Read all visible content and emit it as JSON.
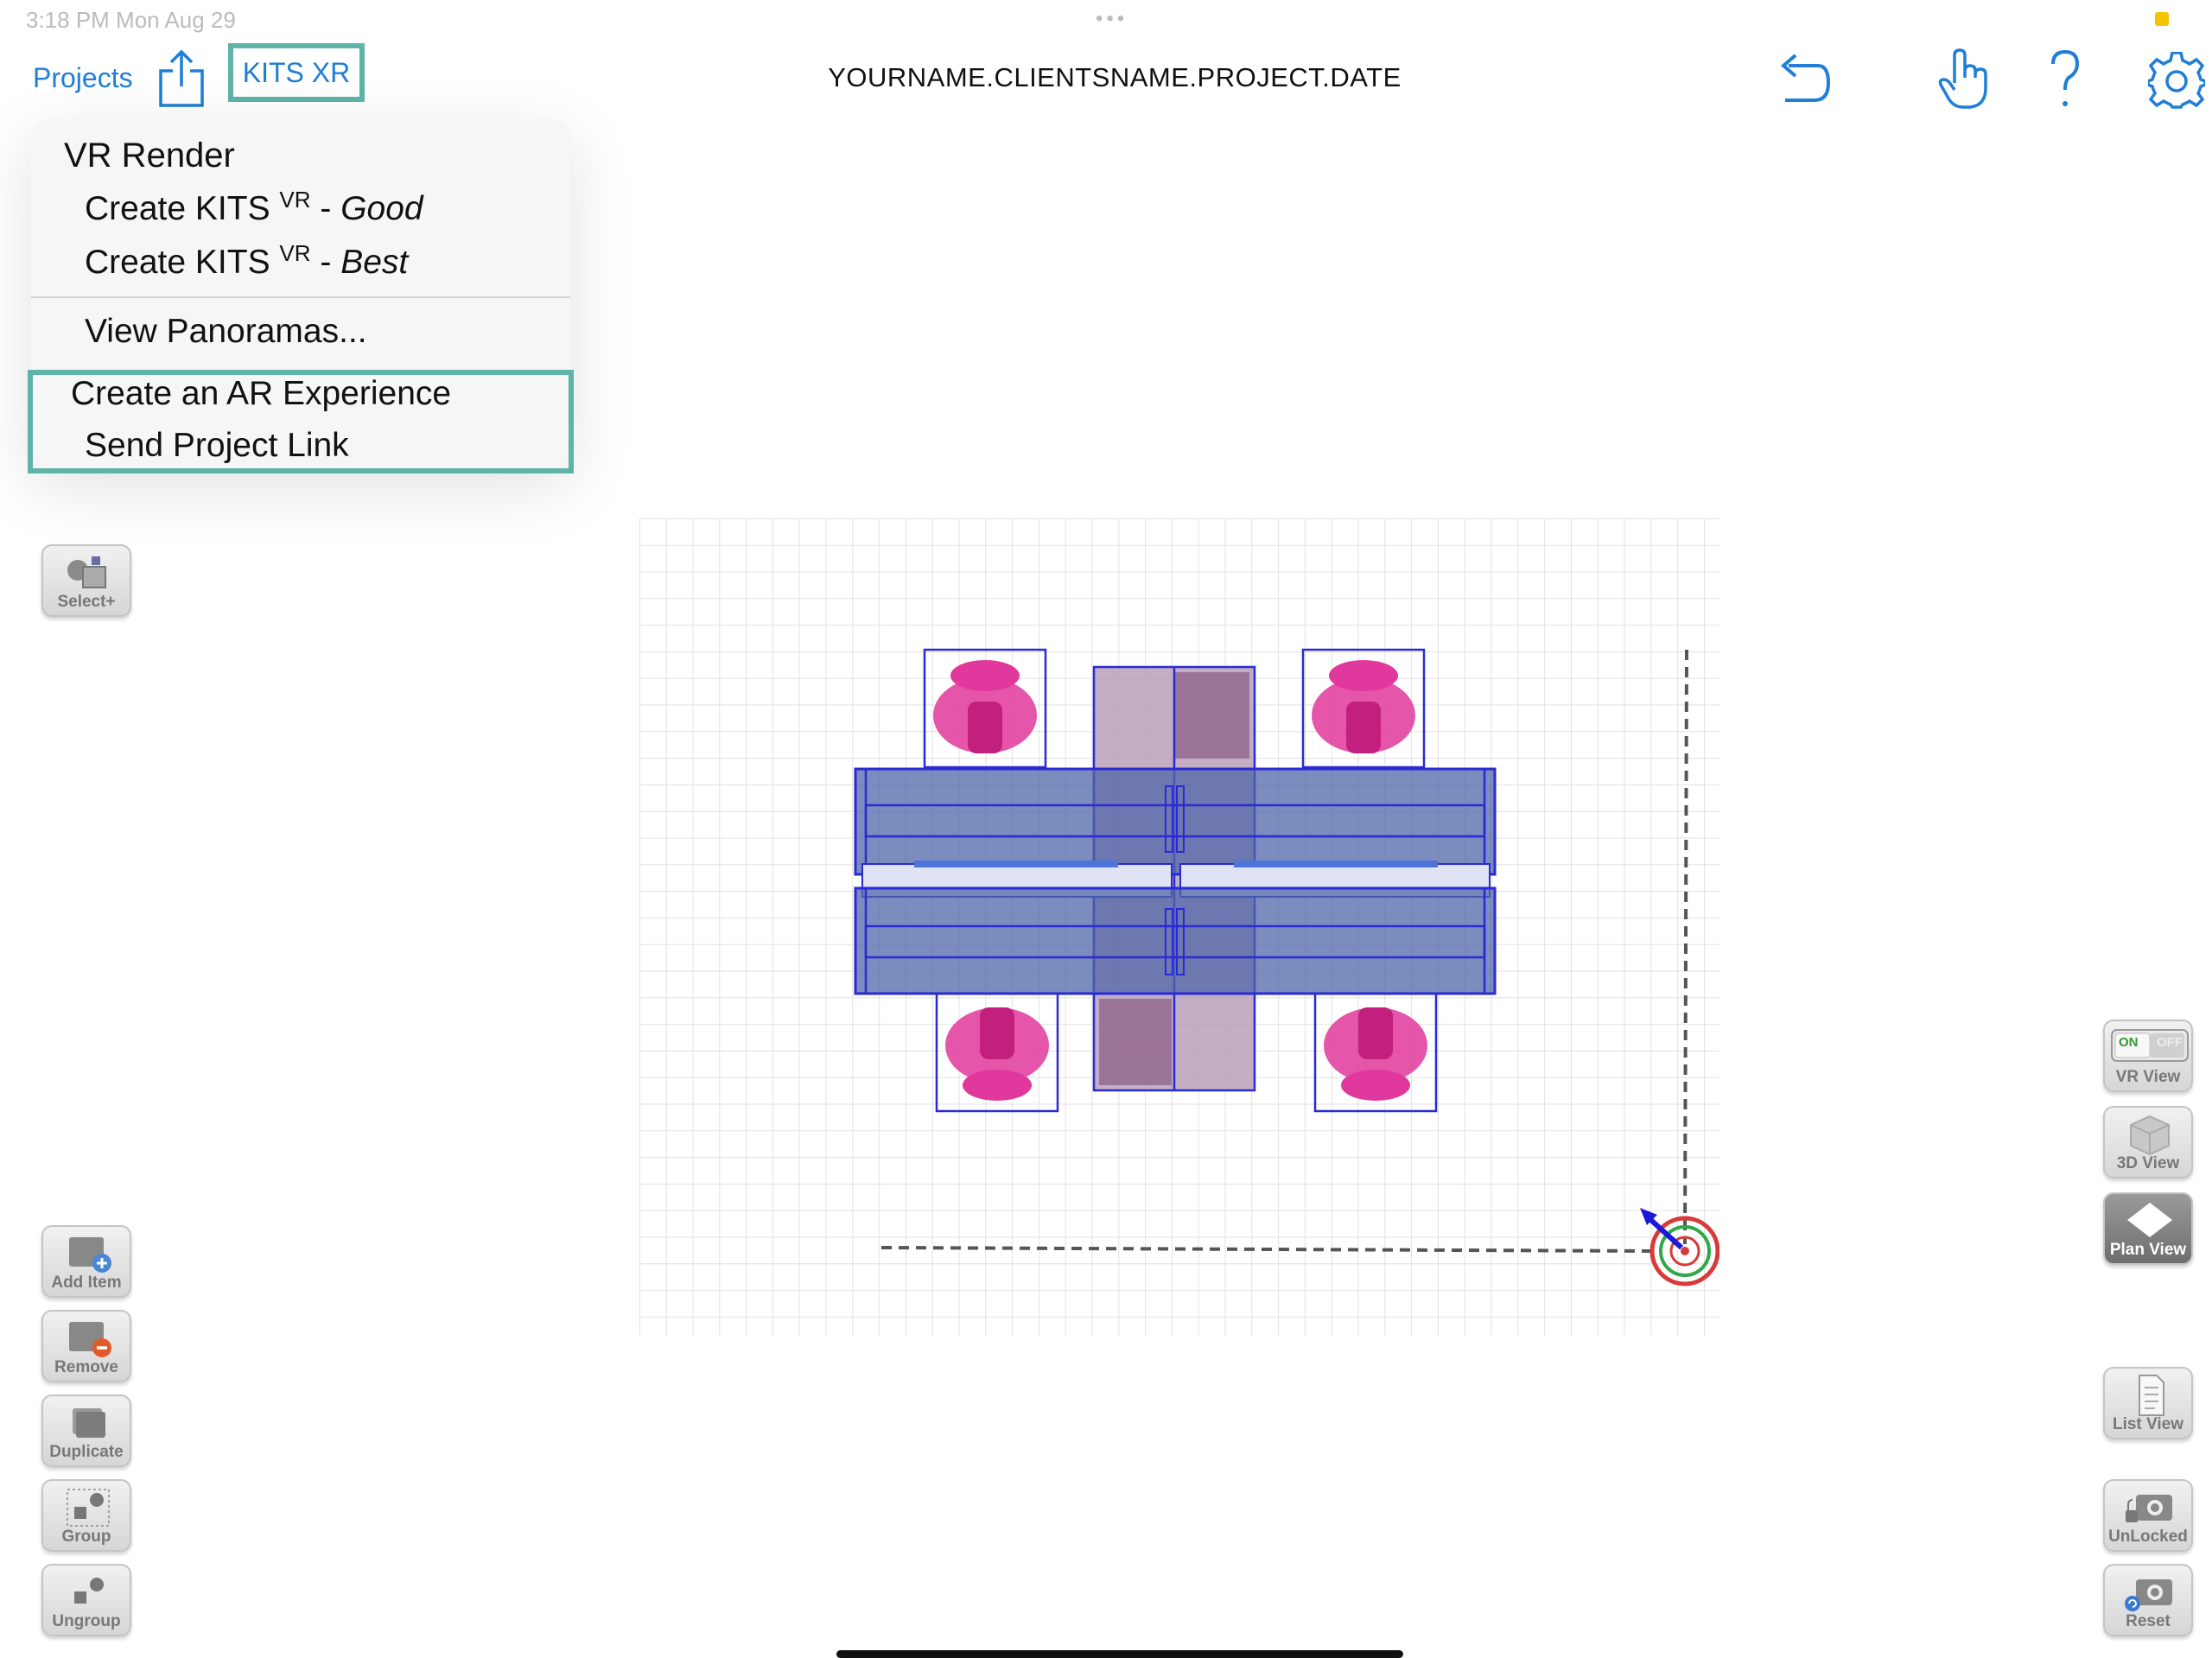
{
  "status_bar": {
    "time": "3:18 PM   Mon Aug 29",
    "dots": "•••"
  },
  "header": {
    "projects_label": "Projects",
    "kits_xr_label": "KITS XR",
    "project_title": "YOURNAME.CLIENTSNAME.PROJECT.DATE"
  },
  "menu": {
    "section_title": "VR Render",
    "create_good": {
      "prefix": "Create KITS ",
      "sup": "VR",
      "sep": " - ",
      "quality": "Good"
    },
    "create_best": {
      "prefix": "Create KITS ",
      "sup": "VR",
      "sep": " - ",
      "quality": "Best"
    },
    "view_panoramas": "View Panoramas...",
    "create_ar": "Create an AR Experience",
    "send_link": "Send Project Link"
  },
  "left_tools": {
    "select_plus": "Select+",
    "add_item": "Add Item",
    "remove": "Remove",
    "duplicate": "Duplicate",
    "group": "Group",
    "ungroup": "Ungroup"
  },
  "right_tools": {
    "vr_view": "VR View",
    "vr_on": "ON",
    "vr_off": "OFF",
    "view_3d": "3D View",
    "plan_view": "Plan View",
    "list_view": "List View",
    "unlocked": "UnLocked",
    "reset": "Reset"
  },
  "colors": {
    "accent": "#1f7ed6",
    "highlight_border": "#5fb3a8",
    "furniture_blue": "#2a2ad4",
    "chair_pink": "#e0389c"
  }
}
